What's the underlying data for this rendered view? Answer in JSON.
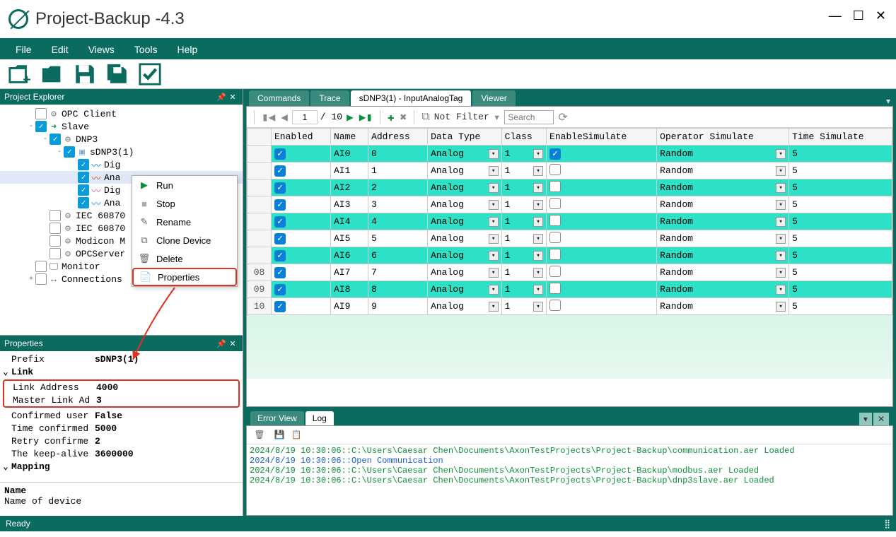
{
  "window": {
    "title": "Project-Backup -4.3"
  },
  "menu": [
    "File",
    "Edit",
    "Views",
    "Tools",
    "Help"
  ],
  "panels": {
    "explorer": {
      "title": "Project Explorer"
    },
    "props": {
      "title": "Properties"
    }
  },
  "tree": {
    "items": [
      {
        "label": "OPC Client",
        "checked": false,
        "level": 1,
        "icon": "gear"
      },
      {
        "label": "Slave",
        "checked": true,
        "level": 1,
        "exp": "-",
        "icon": "arrow"
      },
      {
        "label": "DNP3",
        "checked": true,
        "level": 2,
        "exp": "-",
        "icon": "gear"
      },
      {
        "label": "sDNP3(1)",
        "checked": true,
        "level": 3,
        "exp": "-",
        "icon": "cube"
      },
      {
        "label": "Dig",
        "checked": true,
        "level": 4,
        "icon": "wave-blue"
      },
      {
        "label": "Ana",
        "checked": true,
        "level": 4,
        "sel": true,
        "icon": "wave-red"
      },
      {
        "label": "Dig",
        "checked": true,
        "level": 4,
        "icon": "wave-pink"
      },
      {
        "label": "Ana",
        "checked": true,
        "level": 4,
        "icon": "wave-blue"
      },
      {
        "label": "IEC 60870",
        "checked": false,
        "level": 2,
        "icon": "gear"
      },
      {
        "label": "IEC 60870",
        "checked": false,
        "level": 2,
        "icon": "gear"
      },
      {
        "label": "Modicon M",
        "checked": false,
        "level": 2,
        "icon": "gear"
      },
      {
        "label": "OPCServer",
        "checked": false,
        "level": 2,
        "icon": "gear"
      },
      {
        "label": "Monitor",
        "checked": false,
        "level": 1,
        "icon": "monitor"
      },
      {
        "label": "Connections",
        "checked": false,
        "level": 1,
        "exp": "+",
        "icon": "conn"
      }
    ]
  },
  "context_menu": [
    {
      "label": "Run",
      "icon": "play"
    },
    {
      "label": "Stop",
      "icon": "stop"
    },
    {
      "label": "Rename",
      "icon": "rename"
    },
    {
      "label": "Clone Device",
      "icon": "clone"
    },
    {
      "label": "Delete",
      "icon": "trash"
    },
    {
      "label": "Properties",
      "icon": "props",
      "highlight": true
    }
  ],
  "properties": {
    "rows": [
      {
        "label": "Prefix",
        "value": "sDNP3(1)",
        "indent": true
      },
      {
        "cat": "Link"
      },
      {
        "label": "Link Address",
        "value": "4000",
        "hl": true
      },
      {
        "label": "Master Link Ad",
        "value": "3",
        "hl": true
      },
      {
        "label": "Confirmed user",
        "value": "False"
      },
      {
        "label": "Time confirmed",
        "value": "5000"
      },
      {
        "label": "Retry confirme",
        "value": "2"
      },
      {
        "label": "The keep-alive",
        "value": "3600000"
      },
      {
        "cat": "Mapping"
      }
    ],
    "desc": {
      "name": "Name",
      "text": "Name of device"
    }
  },
  "tabs": {
    "top": [
      {
        "label": "Commands"
      },
      {
        "label": "Trace"
      },
      {
        "label": "sDNP3(1) - InputAnalogTag",
        "active": true
      },
      {
        "label": "Viewer"
      }
    ],
    "bottom": [
      {
        "label": "Error View"
      },
      {
        "label": "Log",
        "active": true
      }
    ]
  },
  "pager": {
    "page": "1",
    "total": "/ 10",
    "filter_label": "Not Filter",
    "search_placeholder": "Search"
  },
  "grid": {
    "columns": [
      "",
      "Enabled",
      "Name",
      "Address",
      "Data Type",
      "Class",
      "EnableSimulate",
      "Operator Simulate",
      "Time Simulate"
    ],
    "rows": [
      {
        "n": "",
        "enabled": true,
        "name": "AI0",
        "addr": "0",
        "dtype": "Analog",
        "cls": "1",
        "esim": true,
        "osim": "Random",
        "tsim": "5",
        "alt": true
      },
      {
        "n": "",
        "enabled": true,
        "name": "AI1",
        "addr": "1",
        "dtype": "Analog",
        "cls": "1",
        "esim": false,
        "osim": "Random",
        "tsim": "5"
      },
      {
        "n": "",
        "enabled": true,
        "name": "AI2",
        "addr": "2",
        "dtype": "Analog",
        "cls": "1",
        "esim": false,
        "osim": "Random",
        "tsim": "5",
        "alt": true
      },
      {
        "n": "",
        "enabled": true,
        "name": "AI3",
        "addr": "3",
        "dtype": "Analog",
        "cls": "1",
        "esim": false,
        "osim": "Random",
        "tsim": "5"
      },
      {
        "n": "",
        "enabled": true,
        "name": "AI4",
        "addr": "4",
        "dtype": "Analog",
        "cls": "1",
        "esim": false,
        "osim": "Random",
        "tsim": "5",
        "alt": true
      },
      {
        "n": "",
        "enabled": true,
        "name": "AI5",
        "addr": "5",
        "dtype": "Analog",
        "cls": "1",
        "esim": false,
        "osim": "Random",
        "tsim": "5"
      },
      {
        "n": "",
        "enabled": true,
        "name": "AI6",
        "addr": "6",
        "dtype": "Analog",
        "cls": "1",
        "esim": false,
        "osim": "Random",
        "tsim": "5",
        "alt": true
      },
      {
        "n": "08",
        "enabled": true,
        "name": "AI7",
        "addr": "7",
        "dtype": "Analog",
        "cls": "1",
        "esim": false,
        "osim": "Random",
        "tsim": "5"
      },
      {
        "n": "09",
        "enabled": true,
        "name": "AI8",
        "addr": "8",
        "dtype": "Analog",
        "cls": "1",
        "esim": false,
        "osim": "Random",
        "tsim": "5",
        "alt": true
      },
      {
        "n": "10",
        "enabled": true,
        "name": "AI9",
        "addr": "9",
        "dtype": "Analog",
        "cls": "1",
        "esim": false,
        "osim": "Random",
        "tsim": "5"
      }
    ]
  },
  "log": [
    {
      "cls": "green",
      "text": "2024/8/19 10:30:06::C:\\Users\\Caesar Chen\\Documents\\AxonTestProjects\\Project-Backup\\communication.aer Loaded"
    },
    {
      "cls": "blue",
      "text": "2024/8/19 10:30:06::Open Communication"
    },
    {
      "cls": "green",
      "text": "2024/8/19 10:30:06::C:\\Users\\Caesar Chen\\Documents\\AxonTestProjects\\Project-Backup\\modbus.aer Loaded"
    },
    {
      "cls": "green",
      "text": "2024/8/19 10:30:06::C:\\Users\\Caesar Chen\\Documents\\AxonTestProjects\\Project-Backup\\dnp3slave.aer Loaded"
    }
  ],
  "status": {
    "text": "Ready"
  }
}
